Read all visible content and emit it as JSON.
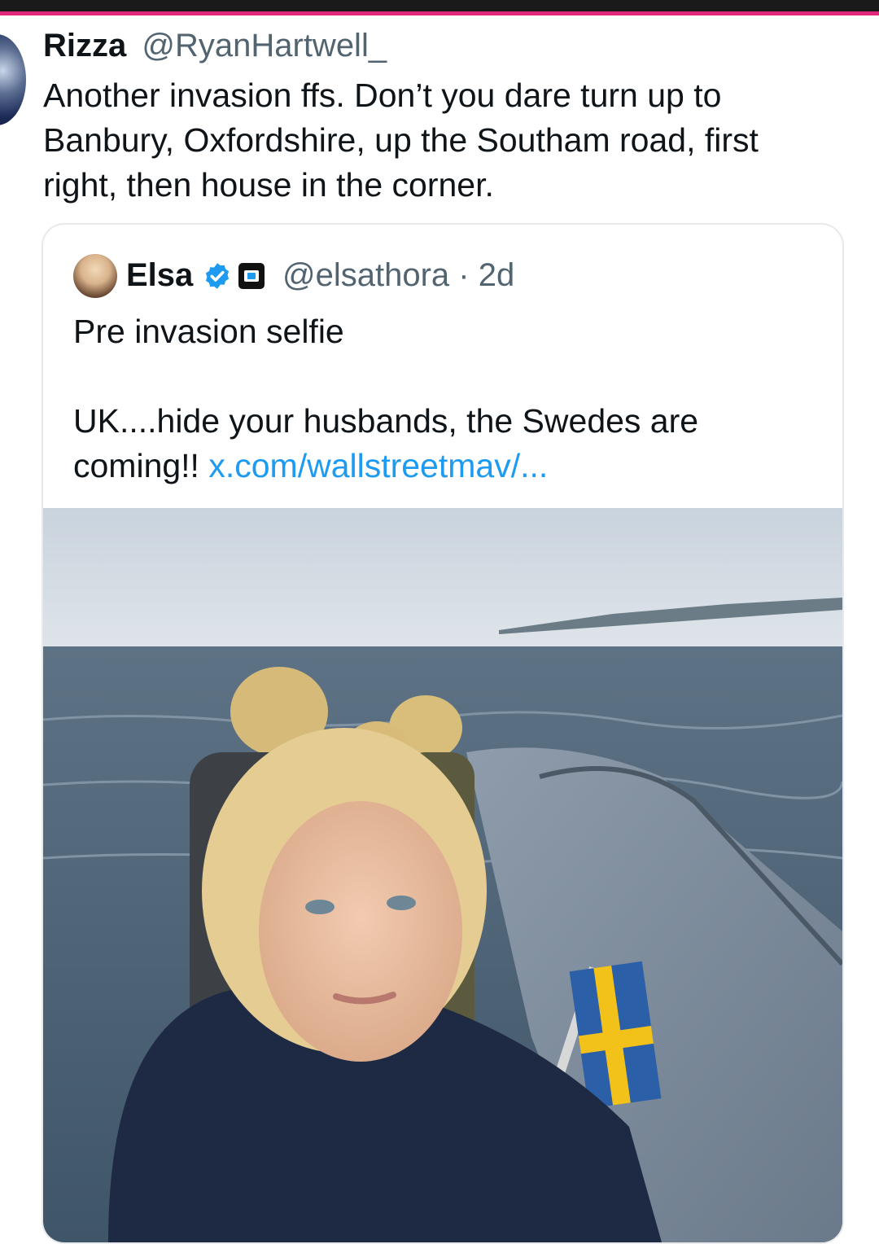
{
  "post": {
    "display_name": "Rizza",
    "handle": "@RyanHartwell_",
    "text_lines": [
      "Another invasion ffs. Don’t you dare turn up to",
      "Banbury, Oxfordshire, up the Southam road, first",
      "right, then house in the corner."
    ]
  },
  "quote": {
    "display_name": "Elsa",
    "meta": "@elsathora · 2d",
    "line1": "Pre invasion selfie",
    "line2": "UK....hide your husbands, the Swedes are",
    "line3_prefix": "coming!! ",
    "link_text": "x.com/wallstreetmav/...",
    "verified_icon": "verified-badge-icon",
    "affiliate_icon": "affiliate-badge-icon"
  },
  "colors": {
    "accent_bar": "#e0267d",
    "link": "#1d9bf0",
    "verified": "#1d9bf0",
    "text": "#0f1419",
    "muted": "#536471"
  }
}
